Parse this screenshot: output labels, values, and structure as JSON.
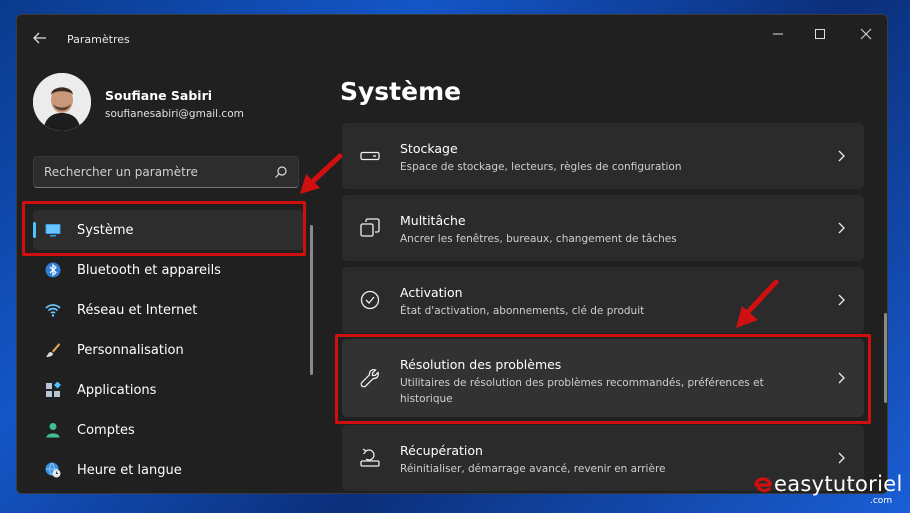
{
  "window": {
    "title": "Paramètres"
  },
  "profile": {
    "name": "Soufiane Sabiri",
    "email": "soufianesabiri@gmail.com"
  },
  "search": {
    "placeholder": "Rechercher un paramètre"
  },
  "nav": {
    "items": [
      {
        "label": "Système",
        "icon": "monitor-icon",
        "selected": true
      },
      {
        "label": "Bluetooth et appareils",
        "icon": "bluetooth-icon"
      },
      {
        "label": "Réseau et Internet",
        "icon": "wifi-icon"
      },
      {
        "label": "Personnalisation",
        "icon": "brush-icon"
      },
      {
        "label": "Applications",
        "icon": "apps-icon"
      },
      {
        "label": "Comptes",
        "icon": "person-icon"
      },
      {
        "label": "Heure et langue",
        "icon": "globe-clock-icon"
      }
    ]
  },
  "main": {
    "title": "Système",
    "cards": [
      {
        "title": "Stockage",
        "desc": "Espace de stockage, lecteurs, règles de configuration",
        "icon": "storage-icon"
      },
      {
        "title": "Multitâche",
        "desc": "Ancrer les fenêtres, bureaux, changement de tâches",
        "icon": "multitask-icon"
      },
      {
        "title": "Activation",
        "desc": "État d'activation, abonnements, clé de produit",
        "icon": "check-circle-icon"
      },
      {
        "title": "Résolution des problèmes",
        "desc": "Utilitaires de résolution des problèmes recommandés, préférences et historique",
        "icon": "wrench-icon"
      },
      {
        "title": "Récupération",
        "desc": "Réinitialiser, démarrage avancé, revenir en arrière",
        "icon": "recovery-icon"
      }
    ]
  },
  "watermark": {
    "brand": "easytutoriel",
    "suffix": ".com"
  },
  "colors": {
    "accent": "#4cc2ff",
    "annotation": "#d01010",
    "window_bg": "#202020",
    "card_bg": "#2b2b2b"
  }
}
